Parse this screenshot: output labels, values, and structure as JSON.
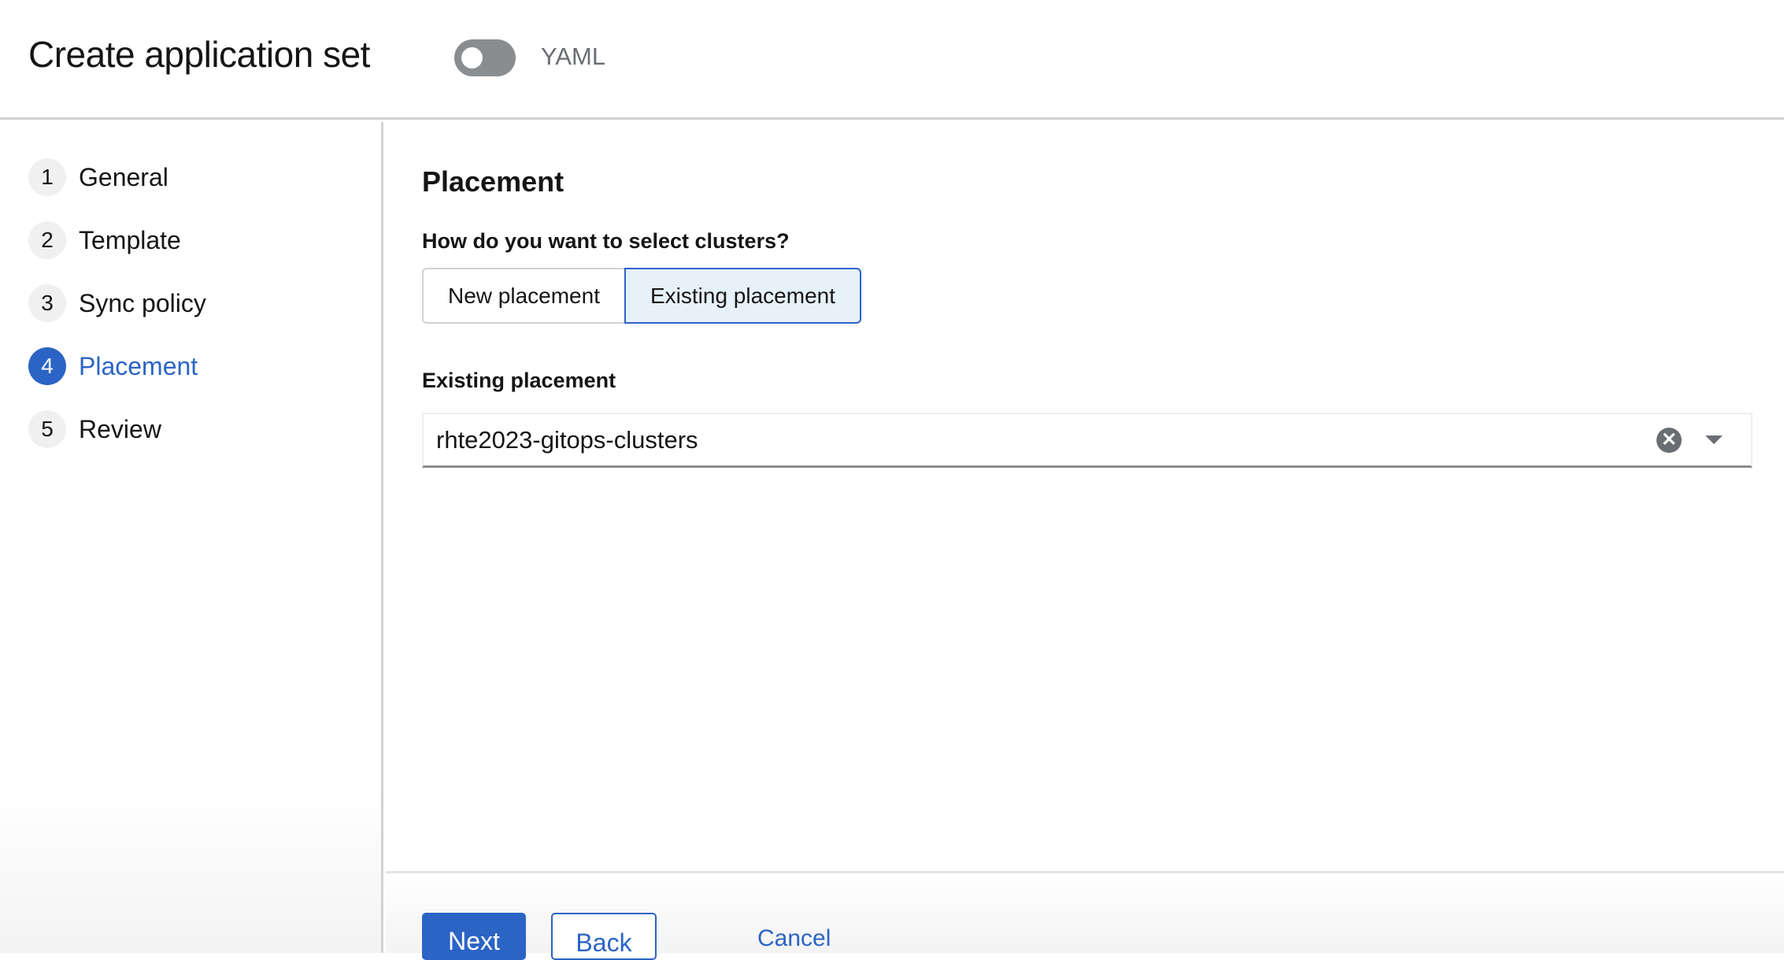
{
  "header": {
    "title": "Create application set",
    "yaml_toggle": {
      "label": "YAML",
      "on": false
    }
  },
  "steps": [
    {
      "number": "1",
      "label": "General"
    },
    {
      "number": "2",
      "label": "Template"
    },
    {
      "number": "3",
      "label": "Sync policy"
    },
    {
      "number": "4",
      "label": "Placement",
      "active": true
    },
    {
      "number": "5",
      "label": "Review"
    }
  ],
  "main": {
    "title": "Placement",
    "question": "How do you want to select clusters?",
    "options": [
      "New placement",
      "Existing placement"
    ],
    "selected_option": "Existing placement",
    "field_label": "Existing placement",
    "field_value": "rhte2023-gitops-clusters"
  },
  "footer": {
    "next": "Next",
    "back": "Back",
    "cancel": "Cancel"
  },
  "colors": {
    "accent": "#2b64c5"
  }
}
